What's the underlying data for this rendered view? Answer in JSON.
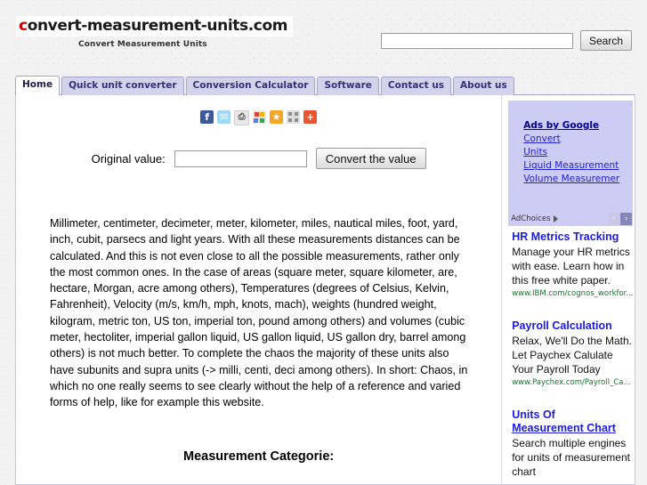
{
  "header": {
    "logo_text_accent": "c",
    "logo_text_rest": "onvert-measurement-units.com",
    "tagline": "Convert Measurement Units",
    "search": {
      "value": "",
      "placeholder": "",
      "button_label": "Search",
      "icon": "search-icon"
    }
  },
  "tabs": [
    {
      "label": "Home",
      "active": true
    },
    {
      "label": "Quick unit converter",
      "active": false
    },
    {
      "label": "Conversion Calculator",
      "active": false
    },
    {
      "label": "Software",
      "active": false
    },
    {
      "label": "Contact us",
      "active": false
    },
    {
      "label": "About us",
      "active": false
    }
  ],
  "social": [
    {
      "name": "facebook-icon",
      "glyph": "f"
    },
    {
      "name": "twitter-icon",
      "glyph": "✉"
    },
    {
      "name": "print-icon",
      "glyph": "⎙"
    },
    {
      "name": "google-share-icon",
      "glyph": ""
    },
    {
      "name": "favorites-star-icon",
      "glyph": "★"
    },
    {
      "name": "share-grid-icon",
      "glyph": ""
    },
    {
      "name": "addthis-plus-icon",
      "glyph": "+"
    }
  ],
  "converter": {
    "label": "Original value:",
    "input_value": "",
    "input_placeholder": "",
    "button_label": "Convert the value"
  },
  "main": {
    "body_text": "Millimeter, centimeter, decimeter, meter, kilometer, miles, nautical miles, foot, yard, inch, cubit, parsecs and light years. With all these measurements distances can be calculated. And this is not even close to all the possible measurements, rather only the most common ones. In the case of areas (square meter, square kilometer, are, hectare, Morgan, acre among others), Temperatures (degrees of Celsius, Kelvin, Fahrenheit), Velocity (m/s, km/h, mph, knots, mach), weights (hundred weight, kilogram, metric ton, US ton, imperial ton, pound among others) and volumes (cubic meter, hectoliter, imperial gallon liquid, US gallon liquid, US gallon dry, barrel among others) is not much better. To complete the chaos the majority of these units also have subunits and supra units (-> milli, centi, deci among others). In short: Chaos, in which no one really seems to see clearly without the help of a reference and varied forms of help, like for example this website.",
    "section_heading": "Measurement Categorie:"
  },
  "sidebar": {
    "ads_by_google_label": "Ads by Google",
    "google_links": [
      "Convert",
      "Units",
      "Liquid Measurement",
      "Volume Measuremer"
    ],
    "adchoices": {
      "label": "AdChoices",
      "prev_glyph": "‹",
      "next_glyph": "›"
    },
    "ads": [
      {
        "title_line1": "HR Metrics Tracking",
        "title_line2": "",
        "desc": "Manage your HR metrics with ease. Learn how in this free white paper.",
        "url": "www.IBM.com/cognos_workfor..."
      },
      {
        "title_line1": "Payroll Calculation",
        "title_line2": "",
        "desc": "Relax, We'll Do the Math. Let Paychex Calulate Your Payroll Today",
        "url": "www.Paychex.com/Payroll_Ca..."
      },
      {
        "title_line1": "Units Of",
        "title_line2": "Measurement Chart",
        "desc": "Search multiple engines for units of measurement chart",
        "url": ""
      }
    ]
  },
  "colors": {
    "page_background": "#f2f2f2",
    "content_background": "#ffffff",
    "tab_inactive": "#d3d3ec",
    "tab_text": "#31317a",
    "ad_block": "#ccccf5",
    "ad_title": "#1a1ae0",
    "ad_url": "#0a7a24",
    "logo_accent": "#cc0000"
  }
}
